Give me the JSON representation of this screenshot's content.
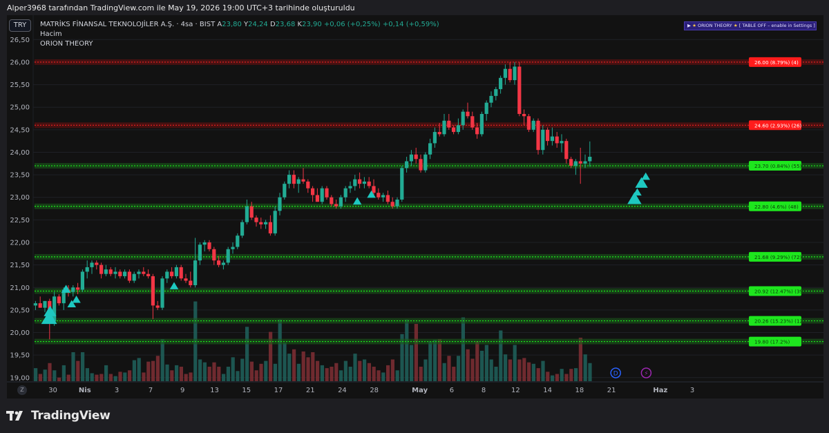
{
  "header": {
    "attribution": "Alper3968 tarafından TradingView.com ile May 19, 2026 19:00 UTC+3 tarihinde oluşturuldu"
  },
  "symbol": {
    "currency": "TRY",
    "name": "MATRİKS FİNANSAL TEKNOLOJİLER A.Ş.",
    "interval": "· 4sa ·",
    "exchange": "BIST",
    "ohlc": [
      {
        "label": "A",
        "value": "23,80"
      },
      {
        "label": "Y",
        "value": "24,24"
      },
      {
        "label": "D",
        "value": "23,68"
      },
      {
        "label": "K",
        "value": "23,90"
      }
    ],
    "change": "+0,06 (+0,25%)",
    "change2": "+0,14 (+0,59%)"
  },
  "indicators": {
    "volume_label": "Hacim",
    "orion_label": "ORION THEORY",
    "orion_box": {
      "prefix": "▶",
      "name": "ORION THEORY",
      "suffix": "[ TABLE OFF – enable in Settings ]"
    }
  },
  "brand": {
    "logo_text": "TradingView",
    "zoom_label": "Z"
  },
  "colors": {
    "up": "#22ab94",
    "down": "#f23645",
    "support": "#18f018",
    "resistance": "#f02020",
    "triangle": "#1ec8c0",
    "background": "#121212"
  },
  "chart_data": {
    "type": "candlestick",
    "y_axis": {
      "min": 19.0,
      "max": 26.5,
      "ticks": [
        "19,00",
        "19,50",
        "20,00",
        "20,50",
        "21,00",
        "21,50",
        "22,00",
        "22,50",
        "23,00",
        "23,50",
        "24,00",
        "24,50",
        "25,00",
        "25,50",
        "26,00",
        "26,50"
      ]
    },
    "x_axis_ticks": [
      {
        "label": "30",
        "slot": 4.2
      },
      {
        "label": "Nis",
        "slot": 11.0
      },
      {
        "label": "3",
        "slot": 17.8
      },
      {
        "label": "7",
        "slot": 25.0
      },
      {
        "label": "9",
        "slot": 31.8
      },
      {
        "label": "13",
        "slot": 38.6
      },
      {
        "label": "15",
        "slot": 45.4
      },
      {
        "label": "17",
        "slot": 52.2
      },
      {
        "label": "21",
        "slot": 59.0
      },
      {
        "label": "24",
        "slot": 65.8
      },
      {
        "label": "28",
        "slot": 72.6
      },
      {
        "label": "May",
        "slot": 82.3
      },
      {
        "label": "6",
        "slot": 89.1
      },
      {
        "label": "8",
        "slot": 95.9
      },
      {
        "label": "12",
        "slot": 102.7
      },
      {
        "label": "14",
        "slot": 109.5
      },
      {
        "label": "18",
        "slot": 116.3
      },
      {
        "label": "21",
        "slot": 123.1
      },
      {
        "label": "Haz",
        "slot": 133.5
      },
      {
        "label": "3",
        "slot": 140.3
      }
    ],
    "levels": [
      {
        "price": 26.0,
        "label": "26.00 (8.79%) (4)",
        "kind": "resistance"
      },
      {
        "price": 24.6,
        "label": "24.60 (2.93%) (26)",
        "kind": "resistance"
      },
      {
        "price": 23.7,
        "label": "23.70 (0.84%) (55)",
        "kind": "support"
      },
      {
        "price": 22.8,
        "label": "22.80 (4.6%) (48)",
        "kind": "support"
      },
      {
        "price": 21.68,
        "label": "21.68 (9.29%) (72)",
        "kind": "support"
      },
      {
        "price": 20.92,
        "label": "20.92 (12.47%) (39)",
        "kind": "support"
      },
      {
        "price": 20.26,
        "label": "20.26 (15.23%) (12)",
        "kind": "support"
      },
      {
        "price": 19.8,
        "label": "19.80 (17.2%)",
        "kind": "support"
      }
    ],
    "candles": [
      [
        20.6,
        20.7,
        20.5,
        20.65,
        0.18
      ],
      [
        20.65,
        20.8,
        20.55,
        20.55,
        0.1
      ],
      [
        20.55,
        20.7,
        20.45,
        20.7,
        0.16
      ],
      [
        20.7,
        20.75,
        19.85,
        20.25,
        0.25
      ],
      [
        20.25,
        20.9,
        20.15,
        20.8,
        0.15
      ],
      [
        20.8,
        20.85,
        20.6,
        20.65,
        0.05
      ],
      [
        20.65,
        21.0,
        20.5,
        20.95,
        0.22
      ],
      [
        20.95,
        21.05,
        20.8,
        20.9,
        0.09
      ],
      [
        20.9,
        21.05,
        20.8,
        21.0,
        0.4
      ],
      [
        21.0,
        21.1,
        20.85,
        20.95,
        0.28
      ],
      [
        20.95,
        21.4,
        20.9,
        21.35,
        0.4
      ],
      [
        21.35,
        21.6,
        21.2,
        21.45,
        0.18
      ],
      [
        21.45,
        21.6,
        21.3,
        21.55,
        0.11
      ],
      [
        21.55,
        21.6,
        21.4,
        21.5,
        0.09
      ],
      [
        21.5,
        21.55,
        21.2,
        21.3,
        0.1
      ],
      [
        21.3,
        21.5,
        21.25,
        21.4,
        0.22
      ],
      [
        21.4,
        21.45,
        21.25,
        21.3,
        0.1
      ],
      [
        21.3,
        21.45,
        21.2,
        21.35,
        0.07
      ],
      [
        21.35,
        21.4,
        21.2,
        21.25,
        0.13
      ],
      [
        21.25,
        21.4,
        21.2,
        21.35,
        0.12
      ],
      [
        21.35,
        21.4,
        21.1,
        21.15,
        0.15
      ],
      [
        21.15,
        21.35,
        21.1,
        21.3,
        0.29
      ],
      [
        21.3,
        21.4,
        21.2,
        21.35,
        0.32
      ],
      [
        21.35,
        21.45,
        21.25,
        21.3,
        0.12
      ],
      [
        21.3,
        21.4,
        21.2,
        21.25,
        0.27
      ],
      [
        21.25,
        21.3,
        20.3,
        20.6,
        0.28
      ],
      [
        20.6,
        20.7,
        20.5,
        20.55,
        0.35
      ],
      [
        20.55,
        21.25,
        20.5,
        21.2,
        0.58
      ],
      [
        21.2,
        21.4,
        21.1,
        21.35,
        0.23
      ],
      [
        21.35,
        21.45,
        21.2,
        21.25,
        0.15
      ],
      [
        21.25,
        21.5,
        21.2,
        21.45,
        0.22
      ],
      [
        21.45,
        21.5,
        21.15,
        21.2,
        0.2
      ],
      [
        21.2,
        21.3,
        21.1,
        21.15,
        0.1
      ],
      [
        21.15,
        21.35,
        21.0,
        21.05,
        0.12
      ],
      [
        21.05,
        22.1,
        21.0,
        21.6,
        1.1
      ],
      [
        21.6,
        22.0,
        21.5,
        21.95,
        0.3
      ],
      [
        21.95,
        22.05,
        21.8,
        22.0,
        0.26
      ],
      [
        22.0,
        22.05,
        21.8,
        21.85,
        0.2
      ],
      [
        21.85,
        21.9,
        21.5,
        21.6,
        0.26
      ],
      [
        21.6,
        21.7,
        21.45,
        21.5,
        0.2
      ],
      [
        21.5,
        21.6,
        21.4,
        21.55,
        0.1
      ],
      [
        21.55,
        21.9,
        21.5,
        21.85,
        0.2
      ],
      [
        21.85,
        22.0,
        21.75,
        21.9,
        0.33
      ],
      [
        21.9,
        22.2,
        21.85,
        22.15,
        0.14
      ],
      [
        22.15,
        22.5,
        22.1,
        22.45,
        0.31
      ],
      [
        22.45,
        22.95,
        22.4,
        22.8,
        0.75
      ],
      [
        22.8,
        22.9,
        22.5,
        22.55,
        0.27
      ],
      [
        22.55,
        22.6,
        22.35,
        22.45,
        0.15
      ],
      [
        22.45,
        22.55,
        22.3,
        22.4,
        0.24
      ],
      [
        22.4,
        22.5,
        22.3,
        22.45,
        0.28
      ],
      [
        22.45,
        22.6,
        22.15,
        22.2,
        0.68
      ],
      [
        22.2,
        22.8,
        22.15,
        22.7,
        0.24
      ],
      [
        22.7,
        23.1,
        22.6,
        23.0,
        0.85
      ],
      [
        23.0,
        23.35,
        22.95,
        23.3,
        0.53
      ],
      [
        23.3,
        23.6,
        23.2,
        23.5,
        0.38
      ],
      [
        23.5,
        23.6,
        23.2,
        23.3,
        0.44
      ],
      [
        23.3,
        23.45,
        23.1,
        23.4,
        0.24
      ],
      [
        23.4,
        23.65,
        23.3,
        23.35,
        0.41
      ],
      [
        23.35,
        23.4,
        23.1,
        23.2,
        0.33
      ],
      [
        23.2,
        23.25,
        22.9,
        23.05,
        0.4
      ],
      [
        23.05,
        23.2,
        22.9,
        22.9,
        0.28
      ],
      [
        22.9,
        23.25,
        22.85,
        23.2,
        0.22
      ],
      [
        23.2,
        23.25,
        22.95,
        23.0,
        0.18
      ],
      [
        23.0,
        23.05,
        22.8,
        22.85,
        0.2
      ],
      [
        22.85,
        22.95,
        22.75,
        22.8,
        0.25
      ],
      [
        22.8,
        23.05,
        22.75,
        23.0,
        0.15
      ],
      [
        23.0,
        23.25,
        22.9,
        23.2,
        0.28
      ],
      [
        23.2,
        23.35,
        23.1,
        23.25,
        0.2
      ],
      [
        23.25,
        23.5,
        23.15,
        23.4,
        0.38
      ],
      [
        23.4,
        23.55,
        23.2,
        23.3,
        0.28
      ],
      [
        23.3,
        23.45,
        23.2,
        23.35,
        0.3
      ],
      [
        23.35,
        23.45,
        23.2,
        23.25,
        0.25
      ],
      [
        23.25,
        23.4,
        23.05,
        23.1,
        0.2
      ],
      [
        23.1,
        23.2,
        22.95,
        23.0,
        0.15
      ],
      [
        23.0,
        23.1,
        22.9,
        23.05,
        0.12
      ],
      [
        23.05,
        23.15,
        22.85,
        22.9,
        0.22
      ],
      [
        22.9,
        23.0,
        22.75,
        22.8,
        0.3
      ],
      [
        22.8,
        23.0,
        22.75,
        22.95,
        0.15
      ],
      [
        22.95,
        23.7,
        22.9,
        23.65,
        0.65
      ],
      [
        23.65,
        23.9,
        23.55,
        23.8,
        0.85
      ],
      [
        23.8,
        24.05,
        23.7,
        23.95,
        0.5
      ],
      [
        23.95,
        24.1,
        23.75,
        23.85,
        0.79
      ],
      [
        23.85,
        23.95,
        23.55,
        23.6,
        0.2
      ],
      [
        23.6,
        24.0,
        23.55,
        23.95,
        0.3
      ],
      [
        23.95,
        24.3,
        23.85,
        24.2,
        0.55
      ],
      [
        24.2,
        24.55,
        24.1,
        24.45,
        0.57
      ],
      [
        24.45,
        24.65,
        24.35,
        24.4,
        0.58
      ],
      [
        24.4,
        24.85,
        24.35,
        24.7,
        0.25
      ],
      [
        24.7,
        24.85,
        24.5,
        24.55,
        0.35
      ],
      [
        24.55,
        24.6,
        24.4,
        24.45,
        0.2
      ],
      [
        24.45,
        24.75,
        24.4,
        24.6,
        0.35
      ],
      [
        24.6,
        24.95,
        24.5,
        24.9,
        0.88
      ],
      [
        24.9,
        25.1,
        24.75,
        24.8,
        0.44
      ],
      [
        24.8,
        24.9,
        24.5,
        24.55,
        0.31
      ],
      [
        24.55,
        24.65,
        24.3,
        24.4,
        0.55
      ],
      [
        24.4,
        24.9,
        24.35,
        24.85,
        0.42
      ],
      [
        24.85,
        25.15,
        24.7,
        25.1,
        0.5
      ],
      [
        25.1,
        25.35,
        25.0,
        25.25,
        0.3
      ],
      [
        25.25,
        25.45,
        25.15,
        25.4,
        0.2
      ],
      [
        25.4,
        25.7,
        25.3,
        25.65,
        0.7
      ],
      [
        25.65,
        25.95,
        25.5,
        25.85,
        0.37
      ],
      [
        25.85,
        26.0,
        25.55,
        25.6,
        0.3
      ],
      [
        25.6,
        26.0,
        25.5,
        25.9,
        0.5
      ],
      [
        25.9,
        26.0,
        24.8,
        24.85,
        0.3
      ],
      [
        24.85,
        24.95,
        24.6,
        24.8,
        0.32
      ],
      [
        24.8,
        24.85,
        24.45,
        24.5,
        0.26
      ],
      [
        24.5,
        24.75,
        24.45,
        24.7,
        0.24
      ],
      [
        24.7,
        24.75,
        23.95,
        24.05,
        0.18
      ],
      [
        24.05,
        24.6,
        23.95,
        24.5,
        0.28
      ],
      [
        24.5,
        24.55,
        24.15,
        24.25,
        0.13
      ],
      [
        24.25,
        24.55,
        24.15,
        24.35,
        0.08
      ],
      [
        24.35,
        24.45,
        24.1,
        24.2,
        0.1
      ],
      [
        24.2,
        24.4,
        24.0,
        24.25,
        0.17
      ],
      [
        24.25,
        24.3,
        23.75,
        23.85,
        0.1
      ],
      [
        23.85,
        23.9,
        23.65,
        23.7,
        0.17
      ],
      [
        23.7,
        23.85,
        23.5,
        23.8,
        0.18
      ],
      [
        23.8,
        24.1,
        23.3,
        23.75,
        0.6
      ],
      [
        23.75,
        23.95,
        23.65,
        23.8,
        0.37
      ],
      [
        23.8,
        24.24,
        23.68,
        23.9,
        0.25
      ]
    ],
    "triangles": [
      {
        "slot": 3.4,
        "price": 20.3,
        "size": 1.0
      },
      {
        "slot": 3.6,
        "price": 20.45,
        "size": 0.8
      },
      {
        "slot": 7.0,
        "price": 20.95,
        "size": 0.6
      },
      {
        "slot": 8.2,
        "price": 20.62,
        "size": 0.55
      },
      {
        "slot": 9.2,
        "price": 20.72,
        "size": 0.55
      },
      {
        "slot": 30.0,
        "price": 21.02,
        "size": 0.55
      },
      {
        "slot": 69.0,
        "price": 22.9,
        "size": 0.55
      },
      {
        "slot": 72.0,
        "price": 23.05,
        "size": 0.55
      },
      {
        "slot": 128.0,
        "price": 22.95,
        "size": 0.9
      },
      {
        "slot": 129.5,
        "price": 23.3,
        "size": 0.8
      },
      {
        "slot": 130.4,
        "price": 23.45,
        "size": 0.55
      },
      {
        "slot": 128.6,
        "price": 23.1,
        "size": 0.55
      }
    ],
    "markers": [
      {
        "slot": 124.0,
        "letter": "D",
        "color": "#2962ff"
      },
      {
        "slot": 130.5,
        "letter": "⚡",
        "color": "#9c27b0"
      }
    ]
  }
}
